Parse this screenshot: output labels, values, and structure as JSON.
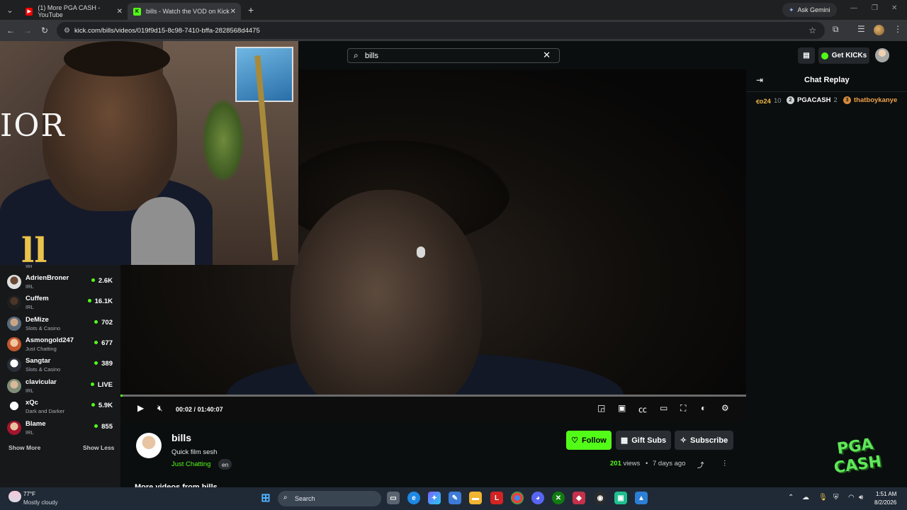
{
  "browser": {
    "tabs": [
      {
        "title": "(1) More PGA CASH - YouTube",
        "icon": "youtube-icon"
      },
      {
        "title": "bills - Watch the VOD on Kick",
        "icon": "kick-icon"
      }
    ],
    "ask_gemini": "Ask Gemini",
    "url": "kick.com/bills/videos/019f9d15-8c98-7410-bffa-2828568d4475"
  },
  "header": {
    "search_value": "bills",
    "get_kicks": "Get KICKs"
  },
  "webcam": {
    "shirt_text": "IOR",
    "jersey_text": "ll"
  },
  "sidebar": {
    "channels": [
      {
        "name": "AdrienBroner",
        "category": "IRL",
        "viewers": "2.6K"
      },
      {
        "name": "Cuffem",
        "category": "IRL",
        "viewers": "16.1K"
      },
      {
        "name": "DeMize",
        "category": "Slots & Casino",
        "viewers": "702"
      },
      {
        "name": "Asmongold247",
        "category": "Just Chatting",
        "viewers": "677"
      },
      {
        "name": "Sangtar",
        "category": "Slots & Casino",
        "viewers": "389"
      },
      {
        "name": "clavicular",
        "category": "IRL",
        "viewers": "LIVE"
      },
      {
        "name": "xQc",
        "category": "Dark and Darker",
        "viewers": "5.9K"
      },
      {
        "name": "Blame",
        "category": "IRL",
        "viewers": "855"
      }
    ],
    "partial_category": "IRL",
    "show_more": "Show More",
    "show_less": "Show Less"
  },
  "player": {
    "current_time": "00:02",
    "separator": "/",
    "duration": "01:40:07",
    "progress": 0.0003
  },
  "chat": {
    "title": "Chat Replay",
    "leaders": [
      {
        "name": "ꞓo24",
        "count": "10",
        "rank": ""
      },
      {
        "name": "PGACASH",
        "count": "2",
        "rank": "2"
      },
      {
        "name": "thatboykanye",
        "count": "",
        "rank": "3"
      }
    ]
  },
  "video_info": {
    "channel": "bills",
    "title": "Quick film sesh",
    "category": "Just Chatting",
    "language": "en",
    "views_count": "201",
    "views_label": "views",
    "age": "7 days ago",
    "follow": "Follow",
    "gift_subs": "Gift Subs",
    "subscribe": "Subscribe",
    "more_videos": "More videos from bills"
  },
  "watermark": {
    "line1": "PGA",
    "line2": "CASH"
  },
  "taskbar": {
    "temp": "77°F",
    "weather": "Mostly cloudy",
    "search": "Search",
    "time": "1:51 AM",
    "date": "8/2/2026"
  },
  "colors": {
    "kick_green": "#53fc18",
    "background": "#0b0e0f"
  }
}
